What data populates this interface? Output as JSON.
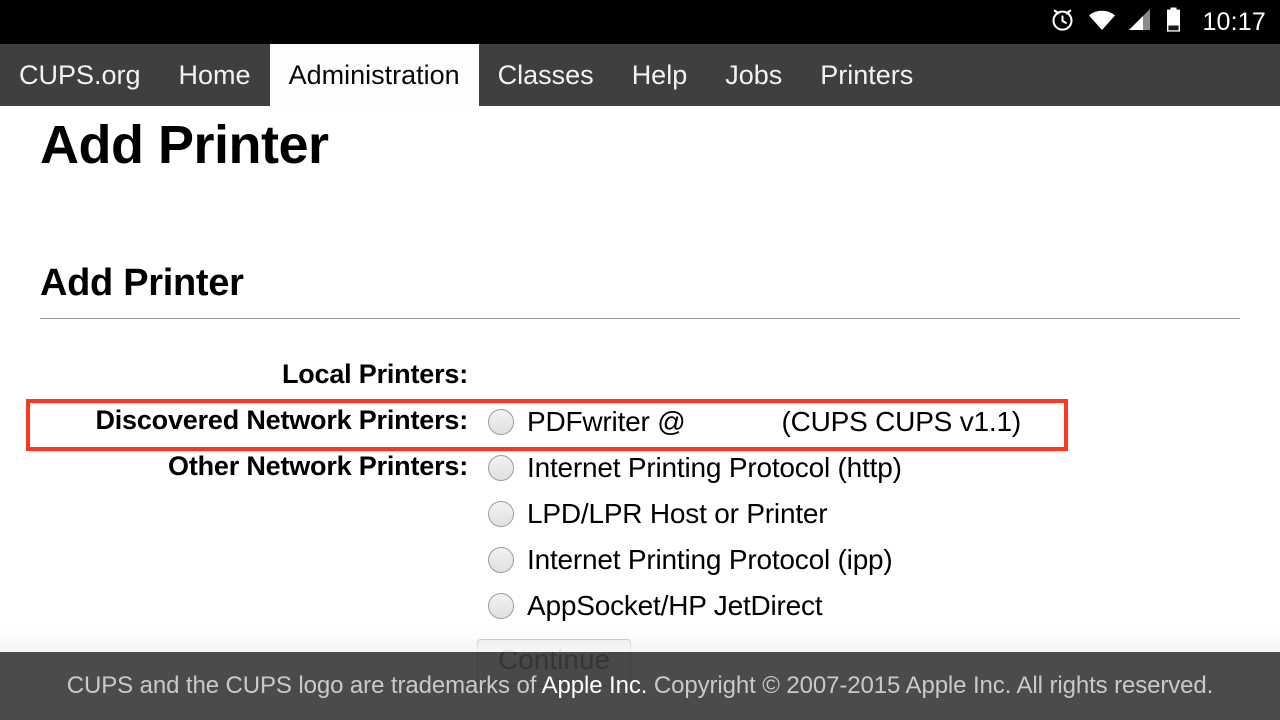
{
  "statusbar": {
    "time": "10:17",
    "icons": [
      "alarm-clock-icon",
      "wifi-icon",
      "cell-signal-icon",
      "battery-icon"
    ]
  },
  "nav": {
    "items": [
      {
        "label": "CUPS.org",
        "active": false
      },
      {
        "label": "Home",
        "active": false
      },
      {
        "label": "Administration",
        "active": true
      },
      {
        "label": "Classes",
        "active": false
      },
      {
        "label": "Help",
        "active": false
      },
      {
        "label": "Jobs",
        "active": false
      },
      {
        "label": "Printers",
        "active": false
      }
    ]
  },
  "page": {
    "title": "Add Printer",
    "section_title": "Add Printer"
  },
  "form": {
    "rows": [
      {
        "label": "Local Printers:",
        "options": []
      },
      {
        "label": "Discovered Network Printers:",
        "options": [
          {
            "label_prefix": "PDFwriter @",
            "label_suffix": "(CUPS CUPS v1.1)",
            "selected": false
          }
        ],
        "highlighted": true
      },
      {
        "label": "Other Network Printers:",
        "options": [
          {
            "label": "Internet Printing Protocol (http)",
            "selected": false
          },
          {
            "label": "LPD/LPR Host or Printer",
            "selected": false
          },
          {
            "label": "Internet Printing Protocol (ipp)",
            "selected": false
          },
          {
            "label": "AppSocket/HP JetDirect",
            "selected": false
          }
        ]
      }
    ],
    "continue_label": "Continue"
  },
  "highlight": {
    "color": "#f93822"
  },
  "footer": {
    "text_before": "CUPS and the CUPS logo are trademarks of ",
    "link": "Apple Inc.",
    "text_after": " Copyright © 2007-2015 Apple Inc. All rights reserved."
  }
}
